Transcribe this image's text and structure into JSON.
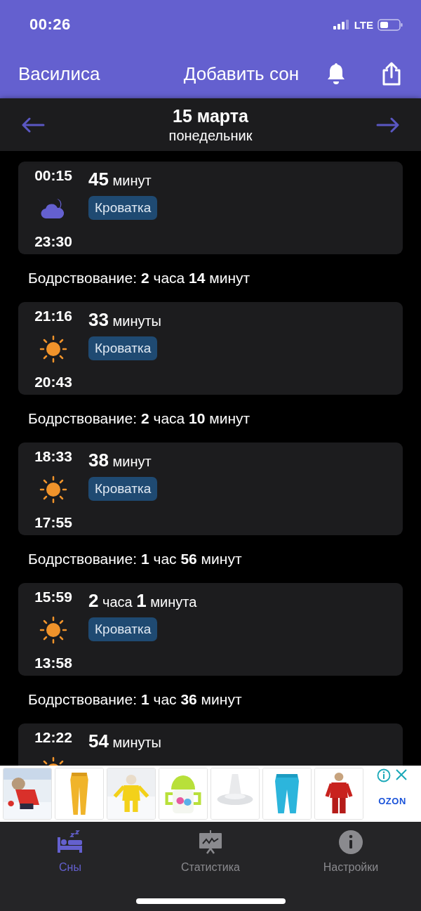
{
  "status_bar": {
    "time": "00:26",
    "network": "LTE"
  },
  "header": {
    "title": "Василиса",
    "action": "Добавить сон"
  },
  "date_bar": {
    "date": "15 марта",
    "weekday": "понедельник"
  },
  "entries": [
    {
      "kind": "night_sleep",
      "start": "23:30",
      "end": "00:15",
      "duration": "**45** минут",
      "tag": "Кроватка"
    },
    {
      "kind": "wake",
      "text": "Бодрствование: **2** часа **14** минут"
    },
    {
      "kind": "day_sleep",
      "start": "20:43",
      "end": "21:16",
      "duration": "**33** минуты",
      "tag": "Кроватка"
    },
    {
      "kind": "wake",
      "text": "Бодрствование: **2** часа **10** минут"
    },
    {
      "kind": "day_sleep",
      "start": "17:55",
      "end": "18:33",
      "duration": "**38** минут",
      "tag": "Кроватка"
    },
    {
      "kind": "wake",
      "text": "Бодрствование: **1** час **56** минут"
    },
    {
      "kind": "day_sleep",
      "start": "13:58",
      "end": "15:59",
      "duration": "**2** часа **1** минута",
      "tag": "Кроватка"
    },
    {
      "kind": "wake",
      "text": "Бодрствование: **1** час **36** минут"
    },
    {
      "kind": "day_sleep",
      "end": "12:22",
      "duration": "**54** минуты"
    }
  ],
  "ad": {
    "brand": "OZON"
  },
  "tabs": [
    {
      "label": "Сны",
      "selected": true
    },
    {
      "label": "Статистика",
      "selected": false
    },
    {
      "label": "Настройки",
      "selected": false
    }
  ]
}
